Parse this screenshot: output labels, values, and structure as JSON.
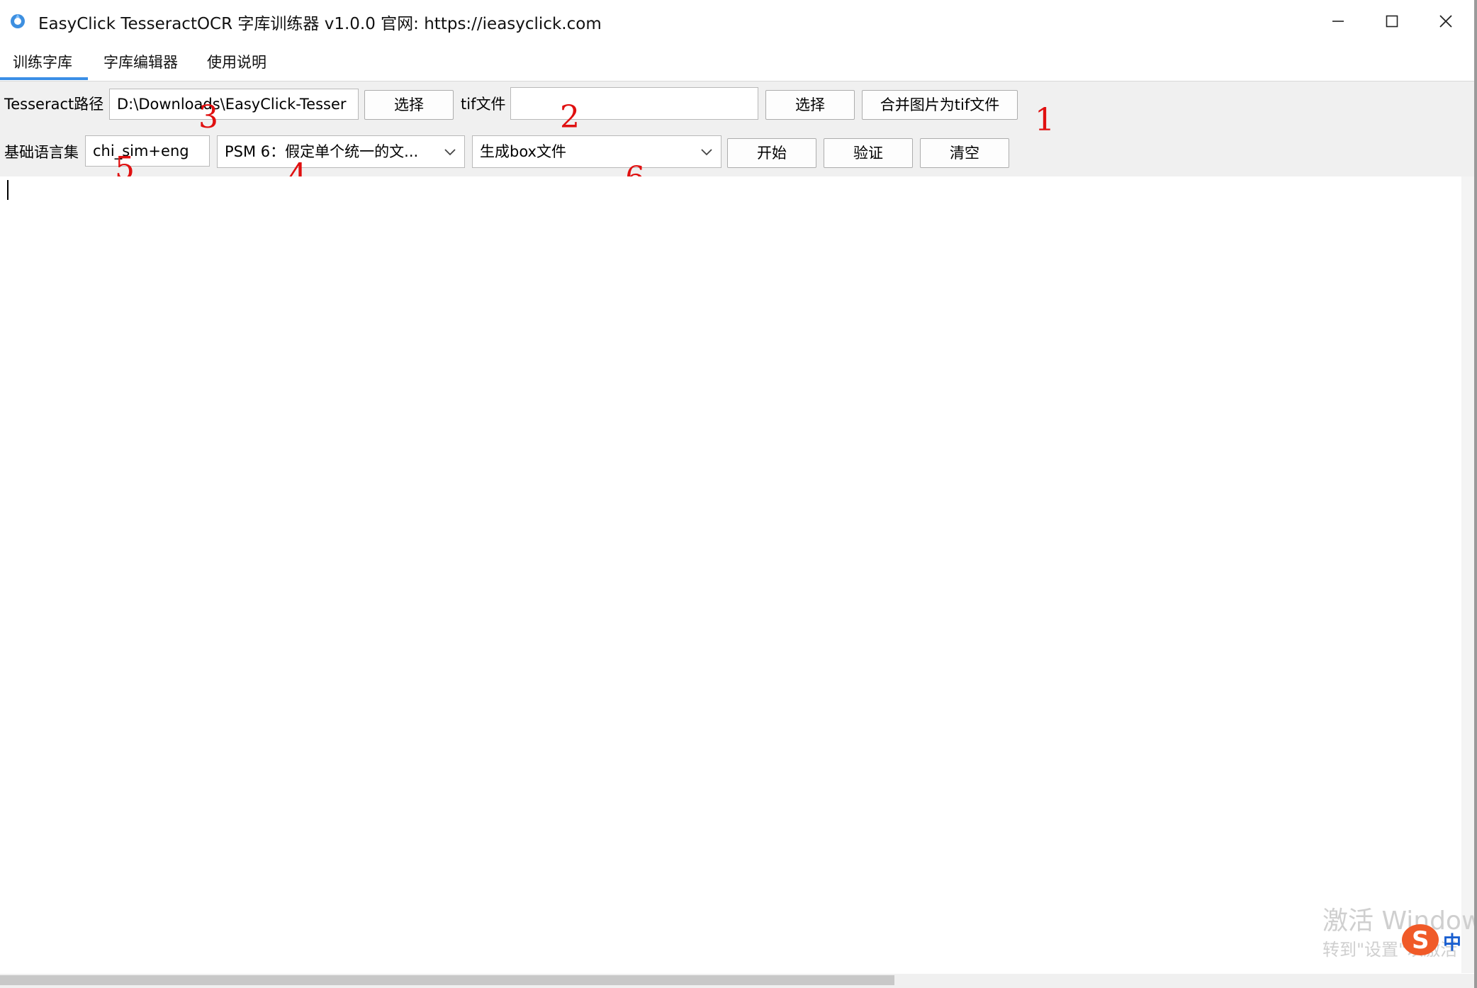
{
  "window": {
    "title": "EasyClick TesseractOCR 字库训练器 v1.0.0 官网: https://ieasyclick.com",
    "controls": {
      "minimize": "—",
      "maximize": "☐",
      "close": "✕"
    }
  },
  "tabs": [
    {
      "label": "训练字库",
      "active": true
    },
    {
      "label": "字库编辑器",
      "active": false
    },
    {
      "label": "使用说明",
      "active": false
    }
  ],
  "row1": {
    "tesseract_label": "Tesseract路径",
    "tesseract_path": "D:\\Downloads\\EasyClick-Tesser",
    "select_button_1": "选择",
    "tif_label": "tif文件",
    "tif_value": "",
    "select_button_2": "选择",
    "merge_button": "合并图片为tif文件"
  },
  "row2": {
    "lang_label": "基础语言集",
    "lang_value": "chi_sim+eng",
    "psm_selected": "PSM 6：假定单个统一的文...",
    "mode_selected": "生成box文件",
    "start_button": "开始",
    "verify_button": "验证",
    "clear_button": "清空"
  },
  "annotations": [
    "1",
    "2",
    "3",
    "4",
    "5",
    "6"
  ],
  "watermark": {
    "line1": "激活 Window",
    "line2": "转到\"设置\"以激活",
    "ime": "中"
  },
  "colors": {
    "accent": "#3a8ee6",
    "annotation": "#e01010"
  }
}
